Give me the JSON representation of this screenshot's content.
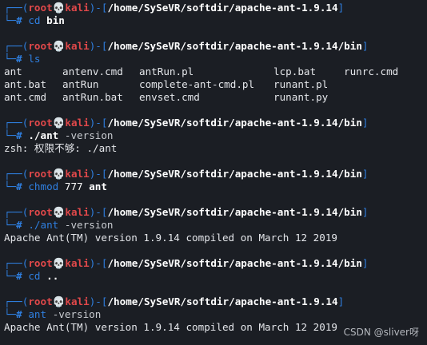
{
  "prompt": {
    "open": "┌──(",
    "user": "root",
    "skull": "💀",
    "host": "kali",
    "mid": ")-[",
    "close": "]",
    "corner": "└─",
    "hash": "# "
  },
  "blocks": [
    {
      "path": "/home/SySeVR/softdir/apache-ant-1.9.14",
      "cmd": "cd",
      "arg": "bin",
      "opt": "",
      "output": []
    },
    {
      "path": "/home/SySeVR/softdir/apache-ant-1.9.14/bin",
      "cmd": "ls",
      "arg": "",
      "opt": "",
      "output": []
    },
    {
      "path": "/home/SySeVR/softdir/apache-ant-1.9.14/bin",
      "cmd": "./ant",
      "arg": "",
      "opt": "-version",
      "output": [
        "zsh: 权限不够: ./ant"
      ]
    },
    {
      "path": "/home/SySeVR/softdir/apache-ant-1.9.14/bin",
      "cmd": "chmod",
      "arg": "ant",
      "opt": "777",
      "output": []
    },
    {
      "path": "/home/SySeVR/softdir/apache-ant-1.9.14/bin",
      "cmd": "./ant",
      "arg": "",
      "opt": "-version",
      "output": [
        "Apache Ant(TM) version 1.9.14 compiled on March 12 2019"
      ]
    },
    {
      "path": "/home/SySeVR/softdir/apache-ant-1.9.14/bin",
      "cmd": "cd",
      "arg": "..",
      "opt": "",
      "output": []
    },
    {
      "path": "/home/SySeVR/softdir/apache-ant-1.9.14",
      "cmd": "ant",
      "arg": "",
      "opt": "-version",
      "output": [
        "Apache Ant(TM) version 1.9.14 compiled on March 12 2019"
      ]
    }
  ],
  "ls_listing": [
    [
      "ant",
      "antenv.cmd",
      "antRun.pl",
      "lcp.bat",
      "runrc.cmd"
    ],
    [
      "ant.bat",
      "antRun",
      "complete-ant-cmd.pl",
      "runant.pl",
      ""
    ],
    [
      "ant.cmd",
      "antRun.bat",
      "envset.cmd",
      "runant.py",
      ""
    ]
  ],
  "watermark": "CSDN @sliver呀"
}
